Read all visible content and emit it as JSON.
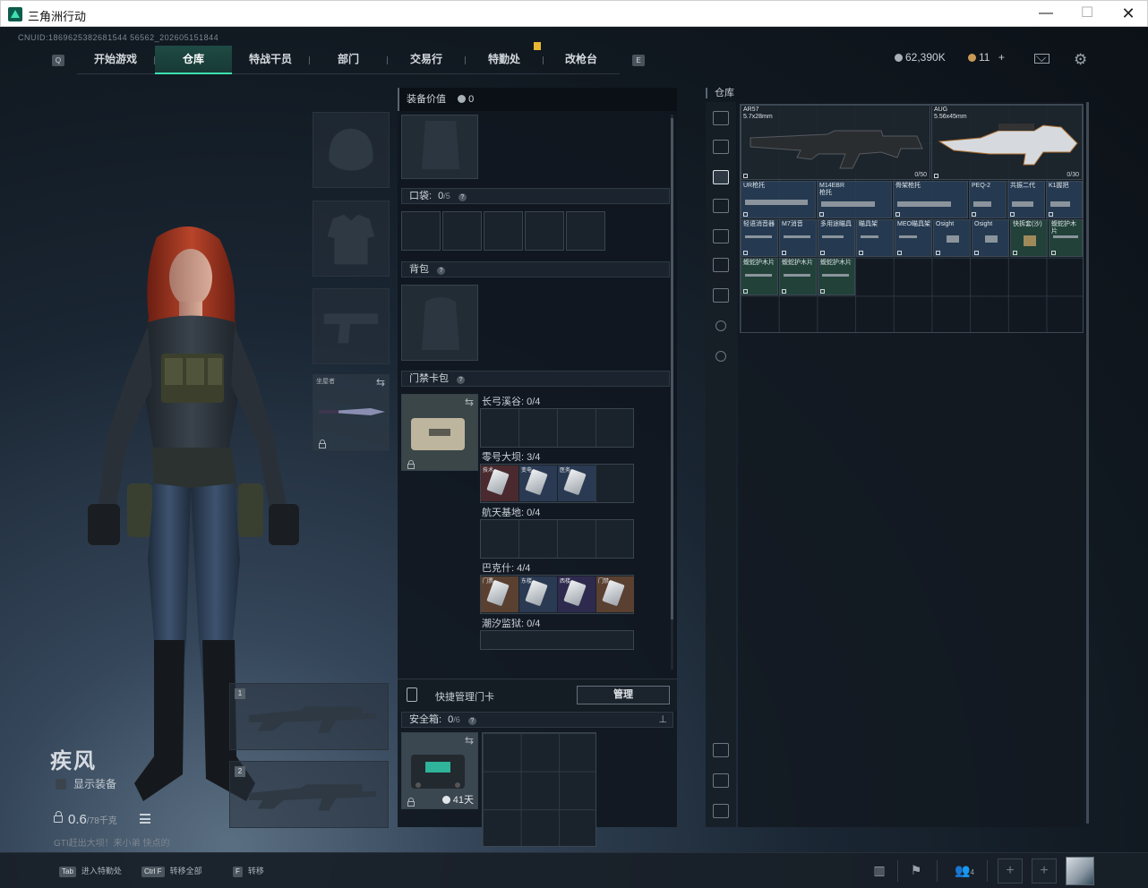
{
  "window": {
    "title": "三角洲行动"
  },
  "top": {
    "cnuid": "CNUID:1869625382681544 56562_202605151844",
    "tabs": [
      "开始游戏",
      "仓库",
      "特战干员",
      "部门",
      "交易行",
      "特勤处",
      "改枪台"
    ],
    "key_q": "Q",
    "key_e": "E",
    "currency": "62,390K",
    "tickets": "11",
    "tickets_plus": "+"
  },
  "character": {
    "name": "疾风",
    "show_equip": "显示装备",
    "weight": "0.6",
    "weight_max": "/78千克",
    "hint": "GTI赶出大坝！来小弟 快点的"
  },
  "slots": {
    "melee_label": "坐屋者",
    "primary_num": "1",
    "secondary_num": "2"
  },
  "center": {
    "equip_value_label": "装备价值",
    "equip_value": "0",
    "pocket_label": "口袋:",
    "pocket_count": "0",
    "pocket_max": "/5",
    "backpack_label": "背包",
    "keycard_label": "门禁卡包",
    "maps": [
      {
        "label": "长弓溪谷: 0/4",
        "cards": []
      },
      {
        "label": "零号大坝: 3/4",
        "cards": [
          "技术",
          "变电",
          "医务"
        ]
      },
      {
        "label": "航天基地: 0/4",
        "cards": []
      },
      {
        "label": "巴克什: 4/4",
        "cards": [
          "门票",
          "东楼",
          "西楼",
          "门禁"
        ]
      },
      {
        "label": "潮汐监狱: 0/4",
        "cards": []
      }
    ],
    "quick_manage": "快捷管理门卡",
    "manage_button": "管理",
    "safebox_label": "安全箱:",
    "safebox_count": "0",
    "safebox_max": "/6",
    "safebox_time": "41天",
    "question": "?"
  },
  "stash": {
    "title": "仓库",
    "items": [
      {
        "name": "AR57\n5.7x28mm",
        "count": "0/50",
        "style": "dark"
      },
      {
        "name": "AUG\n5.56x45mm",
        "count": "0/30",
        "style": "dark"
      },
      {
        "name": "UR枪托",
        "count": "",
        "style": "blue"
      },
      {
        "name": "M14EBR\n枪托",
        "count": "",
        "style": "blue"
      },
      {
        "name": "骨架枪托",
        "count": "",
        "style": "blue"
      },
      {
        "name": "PEQ-2",
        "count": "",
        "style": "blue"
      },
      {
        "name": "共振二代",
        "count": "",
        "style": "blue"
      },
      {
        "name": "K1握把",
        "count": "",
        "style": "blue"
      },
      {
        "name": "轻语消音器",
        "count": "",
        "style": "blue"
      },
      {
        "name": "M7消音",
        "count": "",
        "style": "blue"
      },
      {
        "name": "多用途瞄具",
        "count": "",
        "style": "blue"
      },
      {
        "name": "瞄具架",
        "count": "",
        "style": "blue"
      },
      {
        "name": "MEO瞄具架",
        "count": "",
        "style": "blue"
      },
      {
        "name": "Osight",
        "count": "",
        "style": "blue"
      },
      {
        "name": "Osight",
        "count": "",
        "style": "blue"
      },
      {
        "name": "快拆套(沙)",
        "count": "",
        "style": "green"
      },
      {
        "name": "蝮蛇护木片",
        "count": "",
        "style": "green"
      },
      {
        "name": "蝮蛇护木片",
        "count": "",
        "style": "green"
      },
      {
        "name": "蝮蛇护木片",
        "count": "",
        "style": "green"
      },
      {
        "name": "蝮蛇护木片",
        "count": "",
        "style": "green"
      }
    ]
  },
  "bottom": {
    "hints": [
      {
        "key": "Tab",
        "label": "进入特勤处"
      },
      {
        "key": "Ctrl F",
        "label": "转移全部"
      },
      {
        "key": "F",
        "label": "转移"
      }
    ],
    "friends": "4",
    "plus": "+"
  },
  "colors": {
    "accent": "#3fe0b0",
    "tab_active": "#1f4a44",
    "badge": "#e8b633"
  }
}
